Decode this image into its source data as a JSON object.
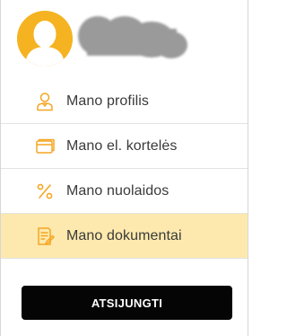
{
  "profile": {
    "avatar_icon": "user-avatar-icon",
    "avatar_color": "#f5b321",
    "name_obscured": true
  },
  "menu": {
    "items": [
      {
        "label": "Mano profilis",
        "icon": "user-icon",
        "active": false
      },
      {
        "label": "Mano el. kortelės",
        "icon": "card-icon",
        "active": false
      },
      {
        "label": "Mano nuolaidos",
        "icon": "percent-icon",
        "active": false
      },
      {
        "label": "Mano dokumentai",
        "icon": "document-icon",
        "active": true
      }
    ]
  },
  "logout": {
    "label": "ATSIJUNGTI"
  },
  "colors": {
    "accent": "#f5a623",
    "active_background": "#fde9ad",
    "button_background": "#050505"
  }
}
